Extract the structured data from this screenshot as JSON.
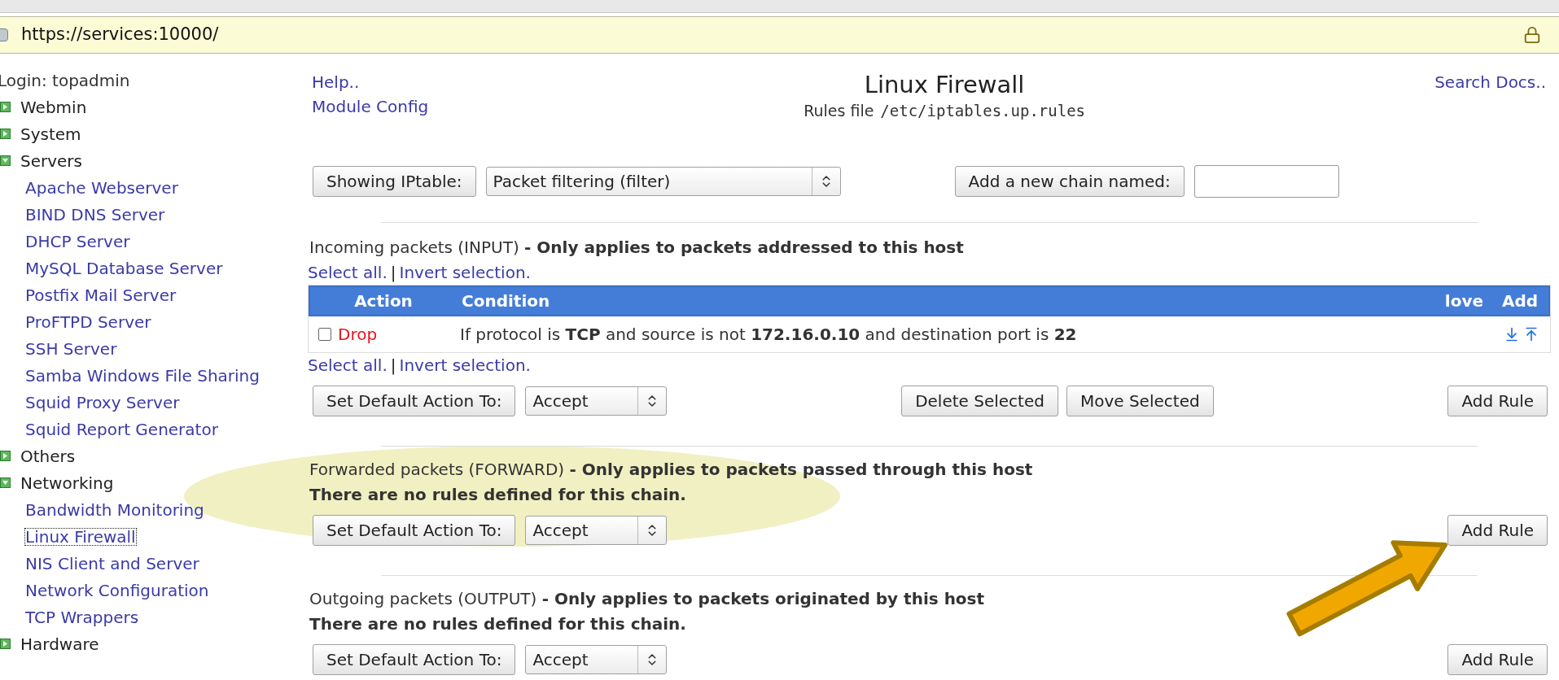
{
  "address_bar": {
    "url": "https://services:10000/"
  },
  "sidebar": {
    "login": "Login: topadmin",
    "items": [
      {
        "label": "Webmin",
        "expanded": false,
        "selected": false
      },
      {
        "label": "System",
        "expanded": false,
        "selected": false
      },
      {
        "label": "Servers",
        "expanded": true,
        "selected": false,
        "children": [
          {
            "label": "Apache Webserver",
            "selected": false
          },
          {
            "label": "BIND DNS Server",
            "selected": false
          },
          {
            "label": "DHCP Server",
            "selected": false
          },
          {
            "label": "MySQL Database Server",
            "selected": false
          },
          {
            "label": "Postfix Mail Server",
            "selected": false
          },
          {
            "label": "ProFTPD Server",
            "selected": false
          },
          {
            "label": "SSH Server",
            "selected": false
          },
          {
            "label": "Samba Windows File Sharing",
            "selected": false
          },
          {
            "label": "Squid Proxy Server",
            "selected": false
          },
          {
            "label": "Squid Report Generator",
            "selected": false
          }
        ]
      },
      {
        "label": "Others",
        "expanded": false,
        "selected": false
      },
      {
        "label": "Networking",
        "expanded": true,
        "selected": false,
        "children": [
          {
            "label": "Bandwidth Monitoring",
            "selected": false
          },
          {
            "label": "Linux Firewall",
            "selected": true
          },
          {
            "label": "NIS Client and Server",
            "selected": false
          },
          {
            "label": "Network Configuration",
            "selected": false
          },
          {
            "label": "TCP Wrappers",
            "selected": false
          }
        ]
      },
      {
        "label": "Hardware",
        "expanded": false,
        "selected": false
      }
    ]
  },
  "header": {
    "links": [
      "Help..",
      "Module Config"
    ],
    "title": "Linux Firewall",
    "subtitle_label": "Rules file",
    "subtitle_path": "/etc/iptables.up.rules",
    "search_link": "Search Docs.."
  },
  "toolbar": {
    "iptable_button": "Showing IPtable:",
    "iptable_select": "Packet filtering (filter)",
    "chain_button": "Add a new chain named:"
  },
  "chains": [
    {
      "heading": "Incoming packets (INPUT) **- Only applies to packets addressed to this host**",
      "selection_links": [
        {
          "select": "Select all.",
          "separator": "|",
          "invert": "Invert selection."
        },
        {
          "select": "Select all.",
          "separator": "|",
          "invert": "Invert selection."
        }
      ],
      "table": {
        "columns": [
          "Action",
          "Condition",
          "love",
          "Add"
        ],
        "rows": [
          {
            "checked": false,
            "action": "Drop",
            "condition": "If protocol is **TCP** and source is not **172.16.0.10** and destination port is **22**"
          }
        ]
      },
      "default_button": "Set Default Action To:",
      "default_value": "Accept",
      "buttons": [
        "Delete Selected",
        "Move Selected"
      ],
      "add_button": "Add Rule"
    },
    {
      "heading": "Forwarded packets (FORWARD) **- Only applies to packets passed through this host**",
      "empty_message": "There are no rules defined for this chain.",
      "default_button": "Set Default Action To:",
      "default_value": "Accept",
      "add_button": "Add Rule"
    },
    {
      "heading": "Outgoing packets (OUTPUT) **- Only applies to packets originated by this host**",
      "empty_message": "There are no rules defined for this chain.",
      "default_button": "Set Default Action To:",
      "default_value": "Accept",
      "add_button": "Add Rule"
    }
  ]
}
